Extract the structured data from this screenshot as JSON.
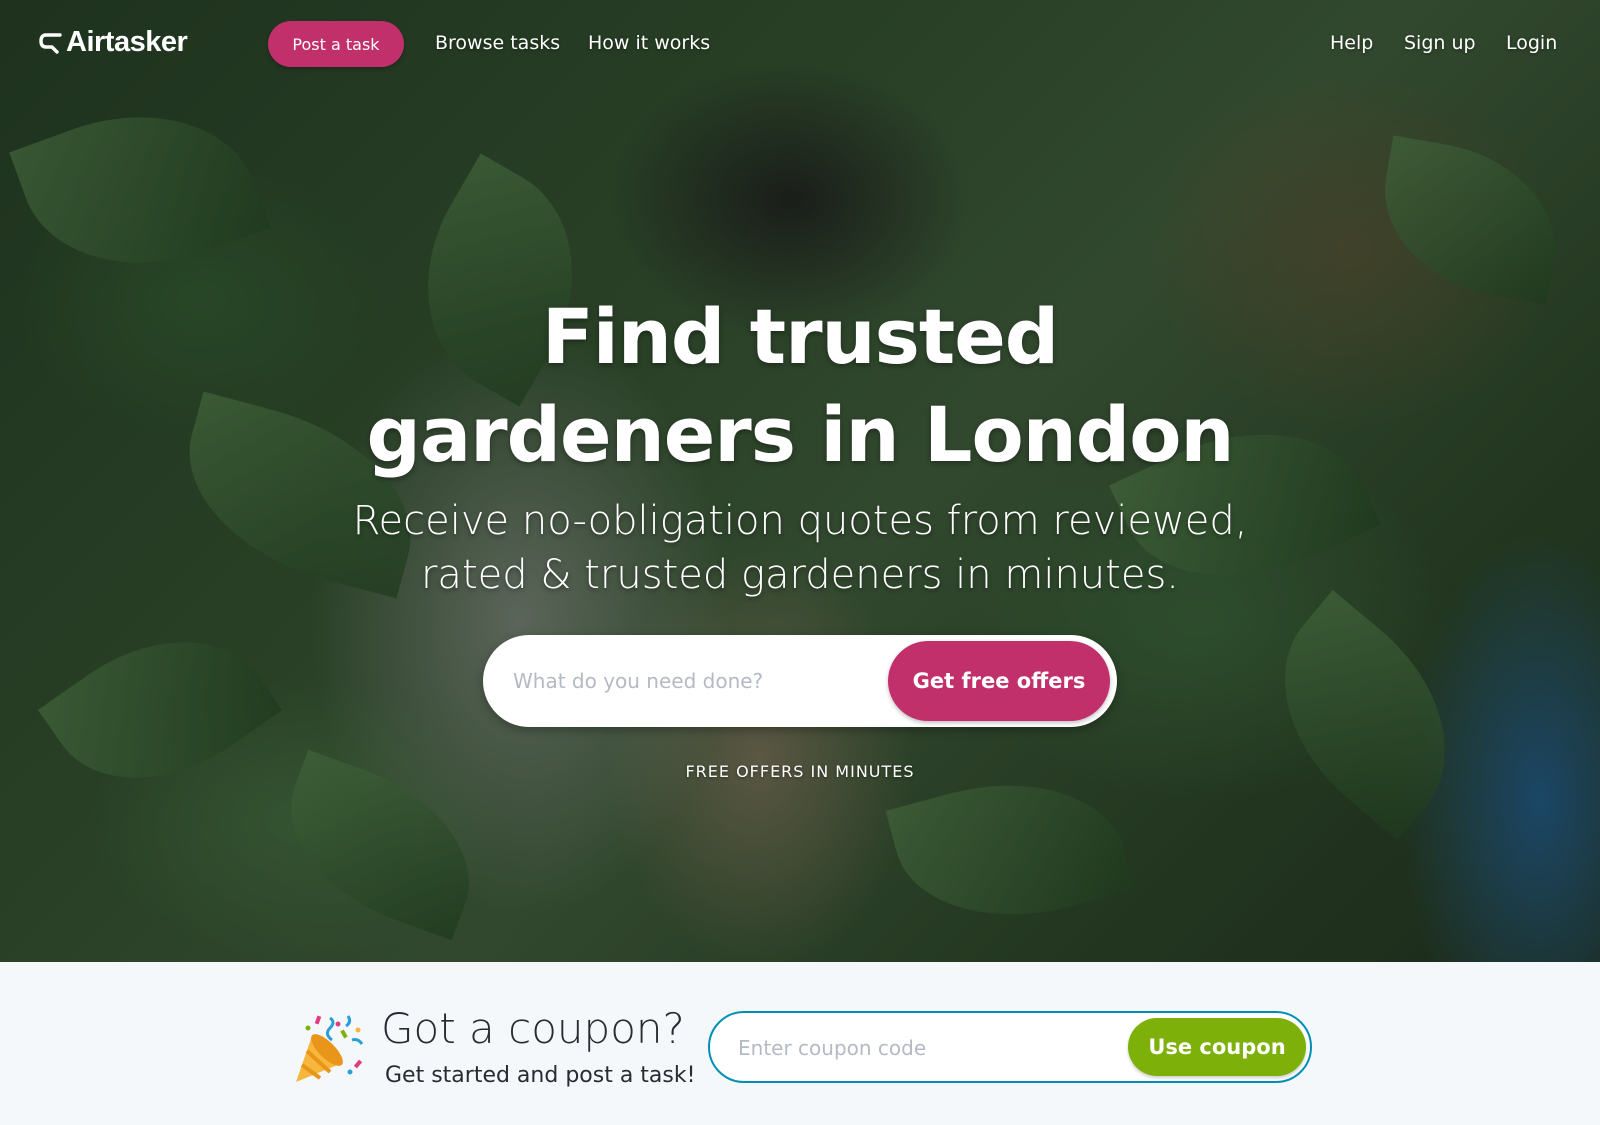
{
  "brand": {
    "name": "Airtasker",
    "primary_color": "#c2306c",
    "accent_color": "#7db10a",
    "border_color": "#008fb4"
  },
  "nav": {
    "post_task": "Post a task",
    "browse_tasks": "Browse tasks",
    "how_it_works": "How it works",
    "help": "Help",
    "sign_up": "Sign up",
    "login": "Login"
  },
  "hero": {
    "title_line1": "Find trusted",
    "title_line2": "gardeners in London",
    "subtitle_line1": "Receive no-obligation quotes from reviewed,",
    "subtitle_line2": "rated & trusted gardeners in minutes.",
    "search_placeholder": "What do you need done?",
    "cta": "Get free offers",
    "note": "FREE OFFERS IN MINUTES"
  },
  "coupon": {
    "icon": "party-popper-icon",
    "title": "Got a coupon?",
    "subtitle": "Get started and post a task!",
    "placeholder": "Enter coupon code",
    "button": "Use coupon"
  }
}
